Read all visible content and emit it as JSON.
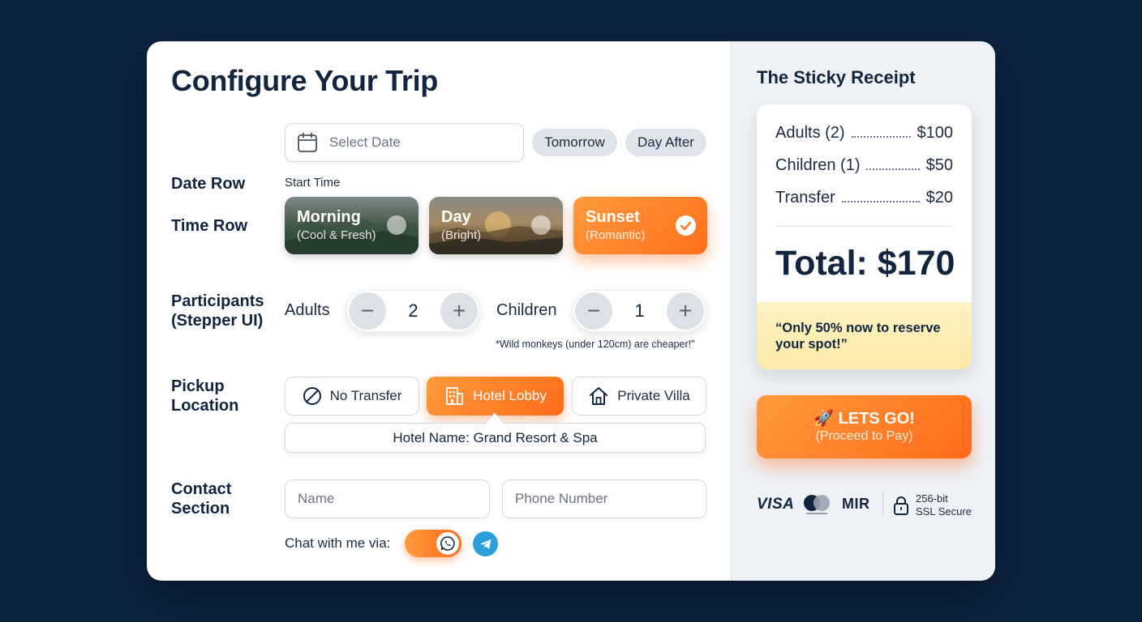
{
  "form": {
    "title": "Configure Your Trip",
    "date_row": {
      "label": "Date Row",
      "placeholder": "Select Date",
      "quick_options": [
        "Tomorrow",
        "Day After"
      ]
    },
    "time_row": {
      "label": "Time Row",
      "caption": "Start Time",
      "options": [
        {
          "title": "Morning",
          "subtitle": "(Cool & Fresh)",
          "selected": false
        },
        {
          "title": "Day",
          "subtitle": "(Bright)",
          "selected": false
        },
        {
          "title": "Sunset",
          "subtitle": "(Romantic)",
          "selected": true
        }
      ]
    },
    "participants": {
      "label_line1": "Participants",
      "label_line2": "(Stepper UI)",
      "adults_label": "Adults",
      "adults_value": "2",
      "children_label": "Children",
      "children_value": "1",
      "note": "*Wild monkeys (under 120cm) are cheaper!\""
    },
    "pickup": {
      "label_line1": "Pickup",
      "label_line2": "Location",
      "options": [
        {
          "label": "No Transfer",
          "icon": "prohibited-icon",
          "selected": false
        },
        {
          "label": "Hotel Lobby",
          "icon": "building-icon",
          "selected": true
        },
        {
          "label": "Private Villa",
          "icon": "home-icon",
          "selected": false
        }
      ],
      "hotel_name": "Hotel Name: Grand Resort & Spa"
    },
    "contact": {
      "label_line1": "Contact",
      "label_line2": "Section",
      "name_placeholder": "Name",
      "phone_placeholder": "Phone Number",
      "chat_label": "Chat with me via:",
      "whatsapp_enabled": true,
      "icons": [
        "whatsapp-icon",
        "telegram-icon"
      ]
    }
  },
  "receipt": {
    "title": "The Sticky Receipt",
    "lines": [
      {
        "label": "Adults (2)",
        "amount": "$100"
      },
      {
        "label": "Children (1)",
        "amount": "$50"
      },
      {
        "label": "Transfer",
        "amount": "$20"
      }
    ],
    "total": "Total: $170",
    "promo": "“Only 50% now to reserve your spot!”",
    "cta_main": "🚀 LETS GO!",
    "cta_sub": "(Proceed to Pay)",
    "payment": {
      "visa": "VISA",
      "mir": "MIR",
      "ssl_line1": "256-bit",
      "ssl_line2": "SSL Secure"
    }
  },
  "colors": {
    "background": "#0c2340",
    "accent": "#ff7a28",
    "heading": "#11253f",
    "telegram": "#2a9fd9",
    "promo_bg": "#fbe9a6"
  }
}
